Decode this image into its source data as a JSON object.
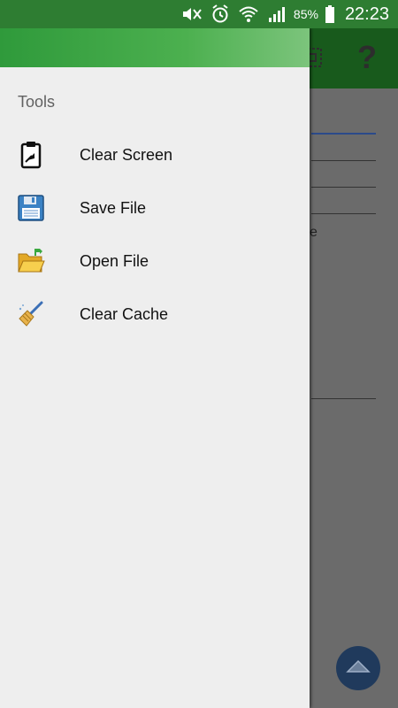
{
  "status_bar": {
    "battery_percent": "85%",
    "time": "22:23",
    "icons": [
      "mute-icon",
      "alarm-icon",
      "wifi-icon",
      "signal-icon",
      "battery-icon"
    ]
  },
  "background_app": {
    "toolbar_icons": [
      "grid-icon",
      "help-icon"
    ],
    "help_glyph": "?",
    "partial_text": "e",
    "fab_icon": "chevron-up-icon",
    "colors": {
      "toolbar": "#185a1c",
      "fab": "#203a5c"
    }
  },
  "drawer": {
    "section_title": "Tools",
    "items": [
      {
        "label": "Clear Screen",
        "icon": "clipboard-icon"
      },
      {
        "label": "Save File",
        "icon": "floppy-disk-icon"
      },
      {
        "label": "Open File",
        "icon": "open-folder-icon"
      },
      {
        "label": "Clear Cache",
        "icon": "broom-icon"
      }
    ],
    "colors": {
      "header_start": "#2f9a3b",
      "header_end": "#7cc47c",
      "background": "#eeeeee"
    }
  }
}
